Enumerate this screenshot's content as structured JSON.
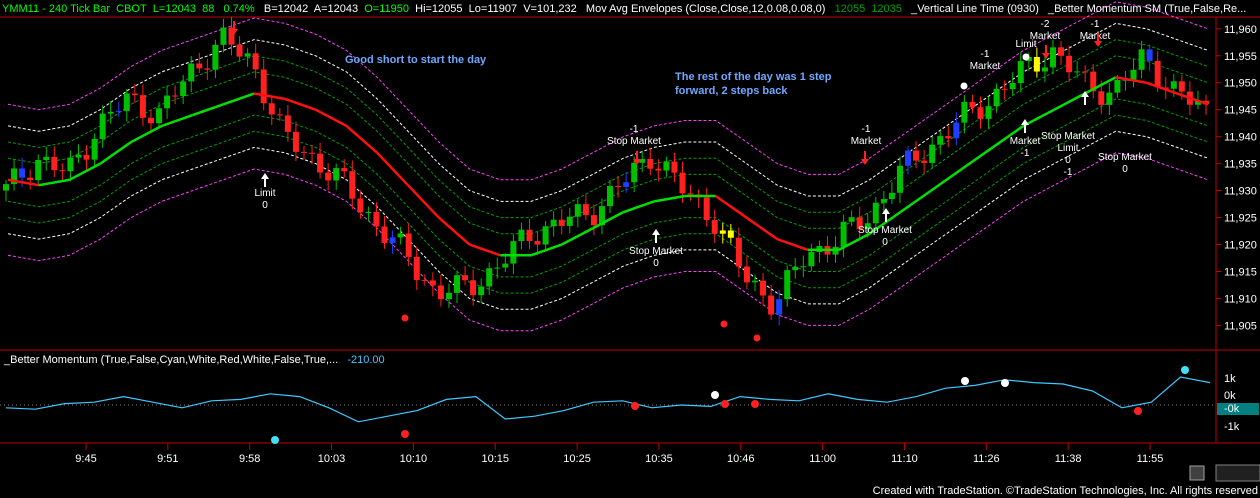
{
  "header": {
    "symbol": "YMM11 - 240 Tick Bar",
    "exchange": "CBOT",
    "last": "L=12043",
    "change": "88",
    "pct": "0.74%",
    "bid": "B=12042",
    "ask": "A=12043",
    "open": "O=11950",
    "high": "Hi=12055",
    "low": "Lo=11907",
    "volume": "V=101,232",
    "study1": "Mov Avg Envelopes (Close,Close,12,0.08,0.08,0)",
    "study1_v1": "12055",
    "study1_v2": "12035",
    "study2": "_Vertical Line Time (0930)",
    "study3": "_Better Momentum SM (True,False,Re..."
  },
  "indicator_header": {
    "label": "_Better Momentum (True,False,Cyan,White,Red,White,False,True,...",
    "value": "-210.00"
  },
  "footer": "Created with TradeStation. ©TradeStation Technologies, Inc. All rights reserved",
  "colors": {
    "up_candle": "#00c000",
    "down_candle": "#ff2020",
    "blue_candle": "#2040ff",
    "yellow_candle": "#ffff00",
    "ma_up": "#00e000",
    "ma_down": "#ff1010",
    "envelope": "#ff40ff",
    "band_white": "#ffffff",
    "band_green": "#00a000",
    "momentum": "#40c8ff",
    "axis_grid": "#c00000"
  },
  "chart_data": [
    {
      "type": "candlestick",
      "x_ticks": [
        "9:45",
        "9:51",
        "9:58",
        "10:03",
        "10:10",
        "10:15",
        "10:25",
        "10:35",
        "10:46",
        "11:00",
        "11:10",
        "11:26",
        "11:38",
        "11:55"
      ],
      "y_ticks": [
        "11,905",
        "11,910",
        "11,915",
        "11,920",
        "11,925",
        "11,930",
        "11,935",
        "11,940",
        "11,945",
        "11,950",
        "11,955",
        "11,960"
      ],
      "y_tick_values": [
        11905,
        11910,
        11915,
        11920,
        11925,
        11930,
        11935,
        11940,
        11945,
        11950,
        11955,
        11960
      ],
      "ylim": [
        11901,
        11962
      ],
      "moving_average": [
        11932,
        11931,
        11932,
        11935,
        11939,
        11942,
        11944,
        11946,
        11948,
        11947,
        11945,
        11942,
        11937,
        11931,
        11925,
        11920,
        11918,
        11918,
        11920,
        11923,
        11926,
        11928,
        11929,
        11929,
        11925,
        11921,
        11919,
        11919,
        11922,
        11926,
        11930,
        11934,
        11938,
        11942,
        11945,
        11948,
        11951,
        11950,
        11948,
        11946
      ],
      "close_path": [
        11930,
        11936,
        11933,
        11942,
        11947,
        11944,
        11952,
        11958,
        11954,
        11940,
        11936,
        11931,
        11924,
        11918,
        11911,
        11912,
        11916,
        11922,
        11924,
        11926,
        11931,
        11937,
        11930,
        11925,
        11914,
        11909,
        11918,
        11921,
        11925,
        11933,
        11938,
        11943,
        11947,
        11952,
        11956,
        11950,
        11948,
        11955,
        11948,
        11945
      ],
      "annotations": [
        {
          "text": "Good short to start the day"
        },
        {
          "text": "The rest of the day was 1 step"
        },
        {
          "text": "forward, 2 steps back"
        }
      ],
      "order_labels": [
        {
          "lines": [
            "Limit",
            "0"
          ]
        },
        {
          "lines": [
            "-1",
            "Stop Market"
          ]
        },
        {
          "lines": [
            "Stop Market",
            "0"
          ]
        },
        {
          "lines": [
            "-1",
            "Market"
          ]
        },
        {
          "lines": [
            "Stop Market",
            "0"
          ]
        },
        {
          "lines": [
            "-1",
            "Market"
          ]
        },
        {
          "lines": [
            "Limit"
          ]
        },
        {
          "lines": [
            "-2",
            "Market"
          ]
        },
        {
          "lines": [
            "-1",
            "Market"
          ]
        },
        {
          "lines": [
            "Market",
            "-1"
          ]
        },
        {
          "lines": [
            "Stop Market",
            "Limit",
            "0",
            "-1"
          ]
        },
        {
          "lines": [
            "Stop Market",
            "0"
          ]
        }
      ]
    },
    {
      "type": "line",
      "name": "_Better Momentum",
      "y_ticks": [
        "1k",
        "0k",
        "-0k",
        "-1k"
      ],
      "values": [
        -0.1,
        -0.15,
        0.05,
        0.1,
        0.3,
        0.1,
        -0.1,
        0.15,
        0.2,
        0.4,
        0.3,
        -0.1,
        -0.6,
        -0.4,
        -0.2,
        0.2,
        0.3,
        -0.5,
        -0.4,
        -0.2,
        0.1,
        0.15,
        -0.1,
        0.0,
        -0.05,
        0.3,
        0.2,
        0.15,
        0.4,
        0.2,
        0.1,
        0.3,
        0.6,
        0.7,
        0.9,
        0.8,
        0.75,
        0.5,
        -0.1,
        0.1,
        1.0,
        0.8
      ]
    }
  ]
}
